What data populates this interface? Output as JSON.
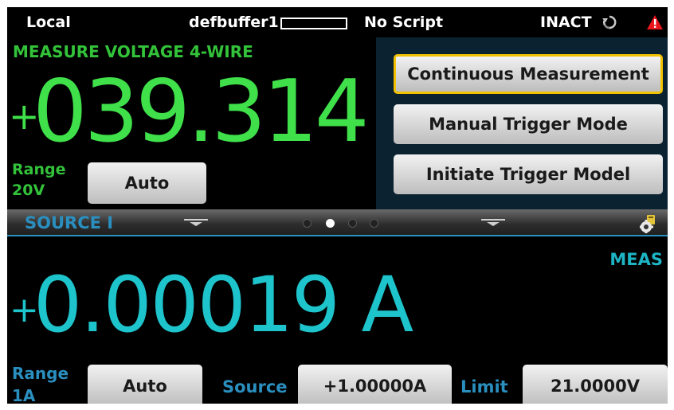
{
  "status_bar": {
    "mode": "Local",
    "buffer": "defbuffer1",
    "script": "No Script",
    "trigger_state": "INACT"
  },
  "measure": {
    "title": "MEASURE VOLTAGE 4-WIRE",
    "sign": "+",
    "value": "039.314",
    "range_label_1": "Range",
    "range_label_2": "20V",
    "range_button": "Auto"
  },
  "menu": {
    "items": [
      "Continuous Measurement",
      "Manual Trigger Mode",
      "Initiate Trigger Model"
    ],
    "selected_index": 0
  },
  "swipe": {
    "title": "SOURCE I",
    "pages": 4,
    "active_page": 1
  },
  "source": {
    "meas_label": "MEAS",
    "sign": "+",
    "value": "0.00019 A",
    "range_label_1": "Range",
    "range_label_2": "1A",
    "range_button": "Auto",
    "source_label": "Source",
    "source_value": "+1.00000A",
    "limit_label": "Limit",
    "limit_value": "21.0000V"
  },
  "colors": {
    "measure_green": "#3fe04a",
    "source_cyan": "#1ec4cc",
    "label_blue": "#2a8fbf",
    "menu_bg": "#0b2230",
    "selected_border": "#f2c200"
  },
  "icons": [
    "refresh-icon",
    "warning-icon",
    "swipe-handle-icon",
    "settings-gear-icon"
  ]
}
